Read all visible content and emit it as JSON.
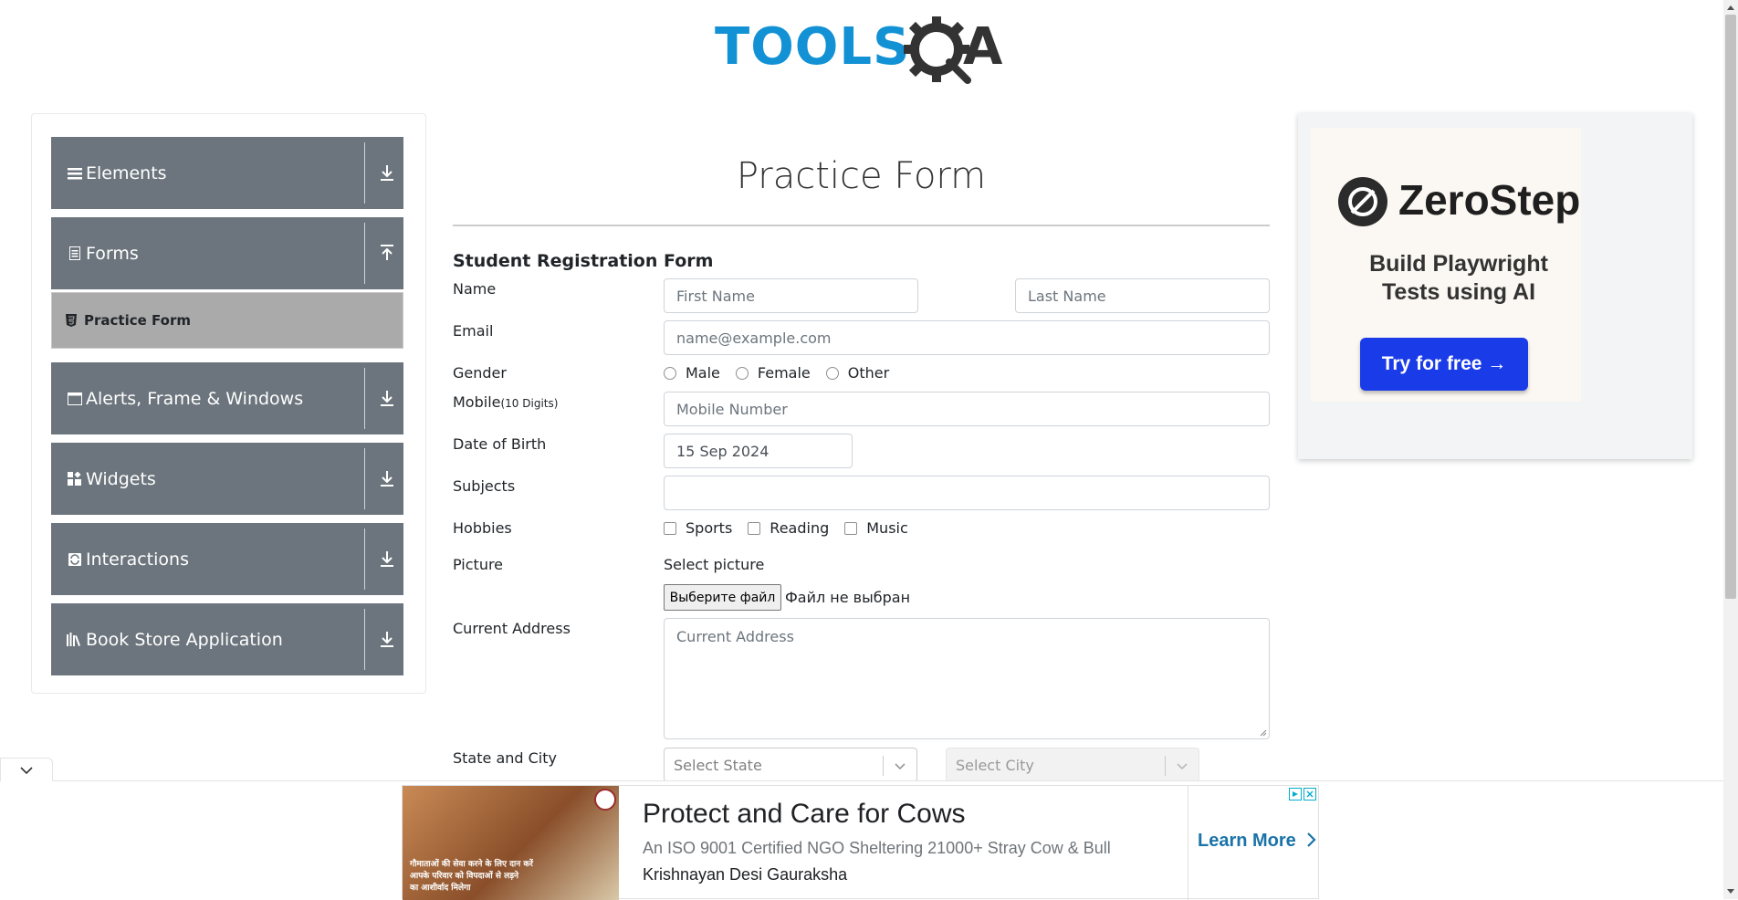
{
  "logo": {
    "text": "TOOLS",
    "suffix": "A"
  },
  "sidebar": {
    "groups": [
      {
        "label": "Elements",
        "icon": "list-icon",
        "expanded": false
      },
      {
        "label": "Forms",
        "icon": "form-icon",
        "expanded": true
      },
      {
        "label": "Alerts, Frame & Windows",
        "icon": "window-icon",
        "expanded": false
      },
      {
        "label": "Widgets",
        "icon": "widgets-icon",
        "expanded": false
      },
      {
        "label": "Interactions",
        "icon": "interactions-icon",
        "expanded": false
      },
      {
        "label": "Book Store Application",
        "icon": "book-icon",
        "expanded": false
      }
    ],
    "active_item": {
      "label": "Practice Form",
      "icon": "html-icon"
    }
  },
  "form": {
    "page_title": "Practice Form",
    "section_title": "Student Registration Form",
    "name_label": "Name",
    "first_name_placeholder": "First Name",
    "last_name_placeholder": "Last Name",
    "email_label": "Email",
    "email_placeholder": "name@example.com",
    "gender_label": "Gender",
    "gender_options": [
      "Male",
      "Female",
      "Other"
    ],
    "mobile_label": "Mobile",
    "mobile_hint": "(10 Digits)",
    "mobile_placeholder": "Mobile Number",
    "dob_label": "Date of Birth",
    "dob_value": "15 Sep 2024",
    "subjects_label": "Subjects",
    "subjects_value": "",
    "hobbies_label": "Hobbies",
    "hobby_options": [
      "Sports",
      "Reading",
      "Music"
    ],
    "picture_label": "Picture",
    "select_picture_text": "Select picture",
    "file_button": "Выберите файл",
    "file_status": "Файл не выбран",
    "address_label": "Current Address",
    "address_placeholder": "Current Address",
    "state_city_label": "State and City",
    "state_placeholder": "Select State",
    "city_placeholder": "Select City"
  },
  "ad_right": {
    "brand": "ZeroStep",
    "tagline_line1": "Build Playwright",
    "tagline_line2": "Tests using AI",
    "button": "Try for free →"
  },
  "ad_bottom": {
    "headline": "Protect and Care for Cows",
    "description": "An ISO 9001 Certified NGO Sheltering 21000+ Stray Cow & Bull",
    "source": "Krishnayan Desi Gauraksha",
    "cta": "Learn More",
    "image_text_line1": "गौमाताओं की सेवा करने के लिए दान करें",
    "image_text_line2": "आपके परिवार को विपदाओं से लड़ने",
    "image_text_line3": "का आशीर्वाद मिलेगा"
  },
  "colors": {
    "sidebar_group": "#6c757d",
    "active_item": "#aaaaaa",
    "logo_blue": "#1291d5",
    "cta_blue": "#1a3be8"
  }
}
